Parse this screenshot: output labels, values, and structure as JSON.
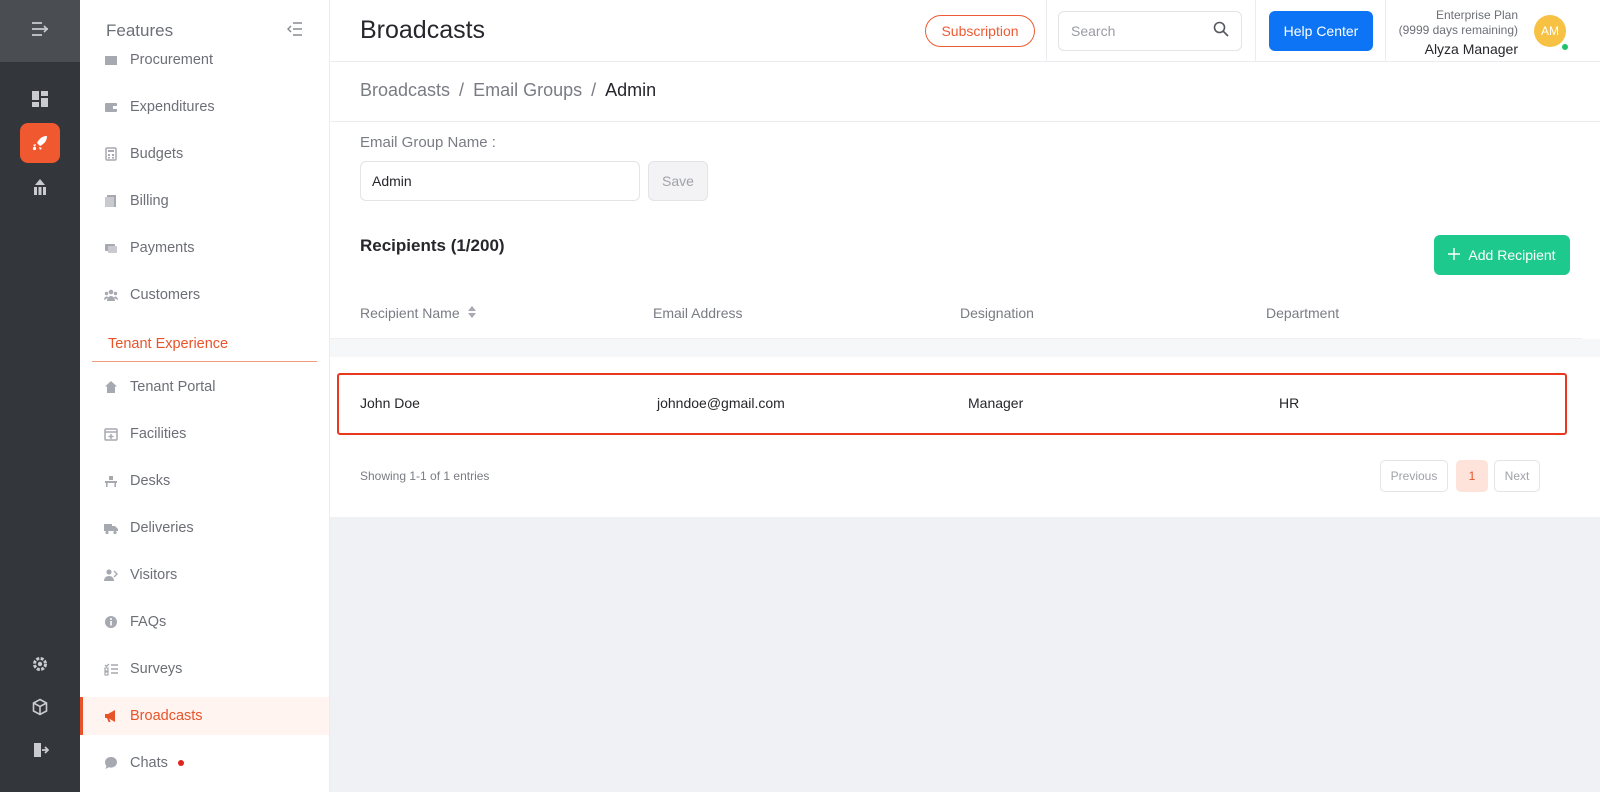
{
  "sidebar": {
    "title": "Features",
    "items": [
      {
        "label": "Procurement"
      },
      {
        "label": "Expenditures"
      },
      {
        "label": "Budgets"
      },
      {
        "label": "Billing"
      },
      {
        "label": "Payments"
      },
      {
        "label": "Customers"
      },
      {
        "label": "Tenant Portal"
      },
      {
        "label": "Facilities"
      },
      {
        "label": "Desks"
      },
      {
        "label": "Deliveries"
      },
      {
        "label": "Visitors"
      },
      {
        "label": "FAQs"
      },
      {
        "label": "Surveys"
      },
      {
        "label": "Broadcasts"
      },
      {
        "label": "Chats"
      }
    ],
    "section_label": "Tenant Experience",
    "active_item": "Broadcasts"
  },
  "header": {
    "title": "Broadcasts",
    "subscription_label": "Subscription",
    "search_placeholder": "Search",
    "help_label": "Help Center",
    "plan_name": "Enterprise Plan",
    "plan_remaining": "(9999 days remaining)",
    "user_name": "Alyza Manager",
    "avatar_initials": "AM"
  },
  "breadcrumb": {
    "items": [
      "Broadcasts",
      "/",
      "Email Groups",
      "/",
      "Admin"
    ]
  },
  "form": {
    "label": "Email Group Name :",
    "value": "Admin",
    "save_label": "Save"
  },
  "recipients": {
    "title": "Recipients (1/200)",
    "add_label": "Add Recipient",
    "columns": [
      "Recipient Name",
      "Email Address",
      "Designation",
      "Department"
    ],
    "rows": [
      {
        "name": "John Doe",
        "email": "johndoe@gmail.com",
        "designation": "Manager",
        "department": "HR"
      }
    ],
    "showing": "Showing 1-1 of 1 entries"
  },
  "pagination": {
    "previous": "Previous",
    "current": "1",
    "next": "Next"
  },
  "colors": {
    "brand": "#f0592f",
    "primary": "#0d74f5",
    "success": "#1ec98e",
    "highlight": "#e8381d"
  }
}
